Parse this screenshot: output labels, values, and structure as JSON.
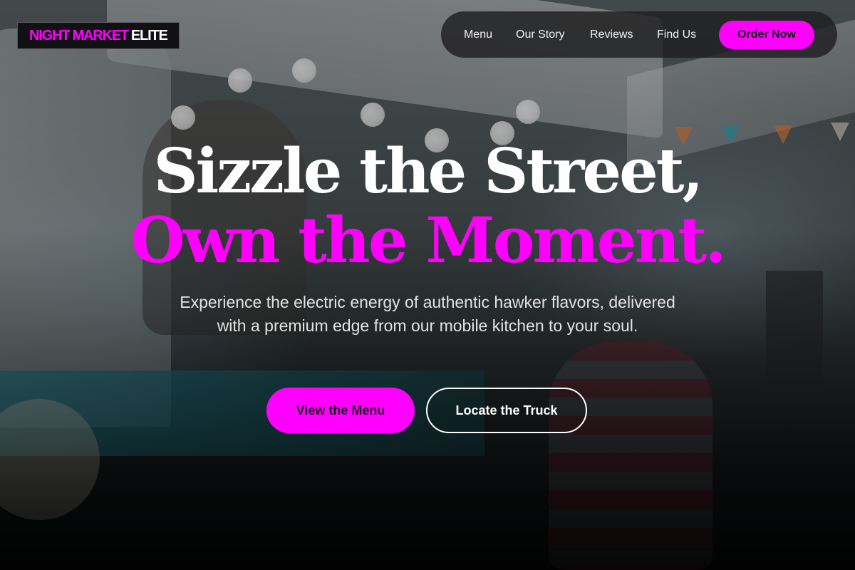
{
  "brand": {
    "accent": "NIGHT MARKET",
    "rest": "ELITE",
    "accent_color": "#ff00ff"
  },
  "nav": {
    "links": [
      "Menu",
      "Our Story",
      "Reviews",
      "Find Us"
    ],
    "cta_label": "Order Now"
  },
  "hero": {
    "headline_line1": "Sizzle the Street,",
    "headline_line2": "Own the Moment.",
    "subcopy": "Experience the electric energy of authentic hawker flavors, delivered with a premium edge from our mobile kitchen to your soul.",
    "primary_button": "View the Menu",
    "secondary_button": "Locate the Truck",
    "background": "food-truck-night-market-photo"
  },
  "colors": {
    "accent": "#ff00ff",
    "text": "#ffffff",
    "nav_bg": "#1e1e20"
  }
}
